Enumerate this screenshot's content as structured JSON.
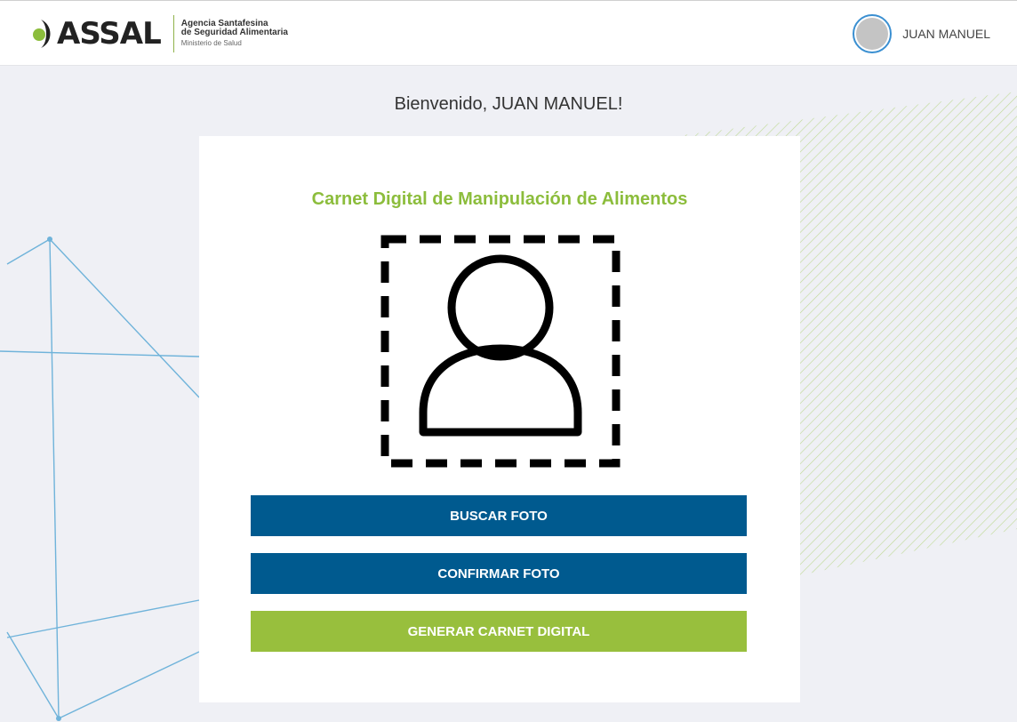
{
  "header": {
    "logo_word": "ASSAL",
    "logo_line1": "Agencia Santafesina",
    "logo_line2": "de Seguridad Alimentaria",
    "logo_line3": "Ministerio de Salud",
    "user_name": "JUAN MANUEL"
  },
  "main": {
    "welcome": "Bienvenido, JUAN MANUEL!",
    "card_title": "Carnet Digital de Manipulación de Alimentos",
    "buttons": {
      "search_photo": "BUSCAR FOTO",
      "confirm_photo": "CONFIRMAR FOTO",
      "generate_card": "GENERAR CARNET DIGITAL"
    }
  },
  "colors": {
    "primary_blue": "#005a8f",
    "accent_green": "#98bf3d",
    "title_green": "#8cbd3c"
  }
}
